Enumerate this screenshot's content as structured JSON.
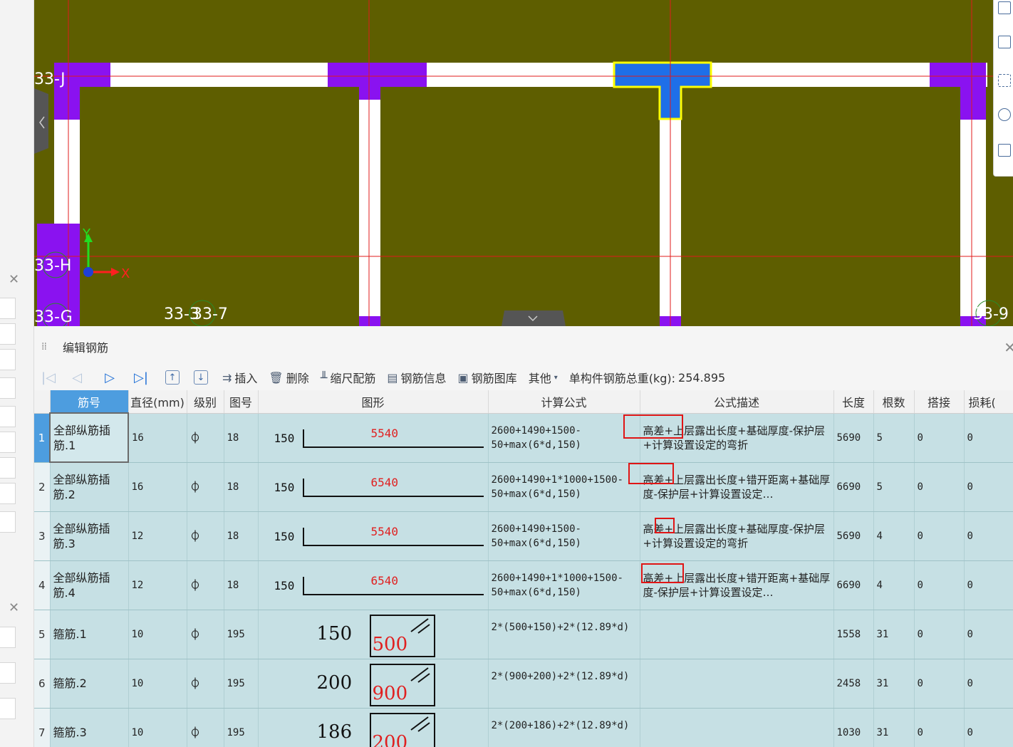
{
  "canvas": {
    "axis_labels": [
      "33-J",
      "33-H",
      "33-G",
      "33-3",
      "33-7",
      "33-9"
    ],
    "axis_y": "Y",
    "axis_x": "X"
  },
  "panel": {
    "title": "编辑钢筋",
    "toolbar": {
      "insert": "插入",
      "delete": "删除",
      "scale_rebar": "缩尺配筋",
      "rebar_info": "钢筋信息",
      "rebar_library": "钢筋图库",
      "other": "其他",
      "total_weight_label": "单构件钢筋总重(kg):",
      "total_weight_value": "254.895"
    },
    "columns": [
      "筋号",
      "直径(mm)",
      "级别",
      "图号",
      "图形",
      "计算公式",
      "公式描述",
      "长度",
      "根数",
      "搭接",
      "损耗("
    ],
    "rows": [
      {
        "num": "1",
        "name": "全部纵筋插筋.1",
        "diameter": "16",
        "grade": "⏀",
        "fig": "18",
        "left": "150",
        "shape_value": "5540",
        "formula": "2600+1490+1500-50+max(6*d,150)",
        "desc": "高差+上层露出长度+基础厚度-保护层+计算设置设定的弯折",
        "length": "5690",
        "count": "5",
        "lap": "0",
        "loss": "0"
      },
      {
        "num": "2",
        "name": "全部纵筋插筋.2",
        "diameter": "16",
        "grade": "⏀",
        "fig": "18",
        "left": "150",
        "shape_value": "6540",
        "formula": "2600+1490+1*1000+1500-50+max(6*d,150)",
        "desc": "高差+上层露出长度+错开距离+基础厚度-保护层+计算设置设定…",
        "length": "6690",
        "count": "5",
        "lap": "0",
        "loss": "0"
      },
      {
        "num": "3",
        "name": "全部纵筋插筋.3",
        "diameter": "12",
        "grade": "⏀",
        "fig": "18",
        "left": "150",
        "shape_value": "5540",
        "formula": "2600+1490+1500-50+max(6*d,150)",
        "desc": "高差+上层露出长度+基础厚度-保护层+计算设置设定的弯折",
        "length": "5690",
        "count": "4",
        "lap": "0",
        "loss": "0"
      },
      {
        "num": "4",
        "name": "全部纵筋插筋.4",
        "diameter": "12",
        "grade": "⏀",
        "fig": "18",
        "left": "150",
        "shape_value": "6540",
        "formula": "2600+1490+1*1000+1500-50+max(6*d,150)",
        "desc": "高差+上层露出长度+错开距离+基础厚度-保护层+计算设置设定…",
        "length": "6690",
        "count": "4",
        "lap": "0",
        "loss": "0"
      },
      {
        "num": "5",
        "name": "箍筋.1",
        "diameter": "10",
        "grade": "⏀",
        "fig": "195",
        "left": "150",
        "shape_value": "500",
        "formula": "2*(500+150)+2*(12.89*d)",
        "desc": "",
        "length": "1558",
        "count": "31",
        "lap": "0",
        "loss": "0"
      },
      {
        "num": "6",
        "name": "箍筋.2",
        "diameter": "10",
        "grade": "⏀",
        "fig": "195",
        "left": "200",
        "shape_value": "900",
        "formula": "2*(900+200)+2*(12.89*d)",
        "desc": "",
        "length": "2458",
        "count": "31",
        "lap": "0",
        "loss": "0"
      },
      {
        "num": "7",
        "name": "箍筋.3",
        "diameter": "10",
        "grade": "⏀",
        "fig": "195",
        "left": "186",
        "shape_value": "200",
        "formula": "2*(200+186)+2*(12.89*d)",
        "desc": "",
        "length": "1030",
        "count": "31",
        "lap": "0",
        "loss": "0"
      }
    ]
  }
}
